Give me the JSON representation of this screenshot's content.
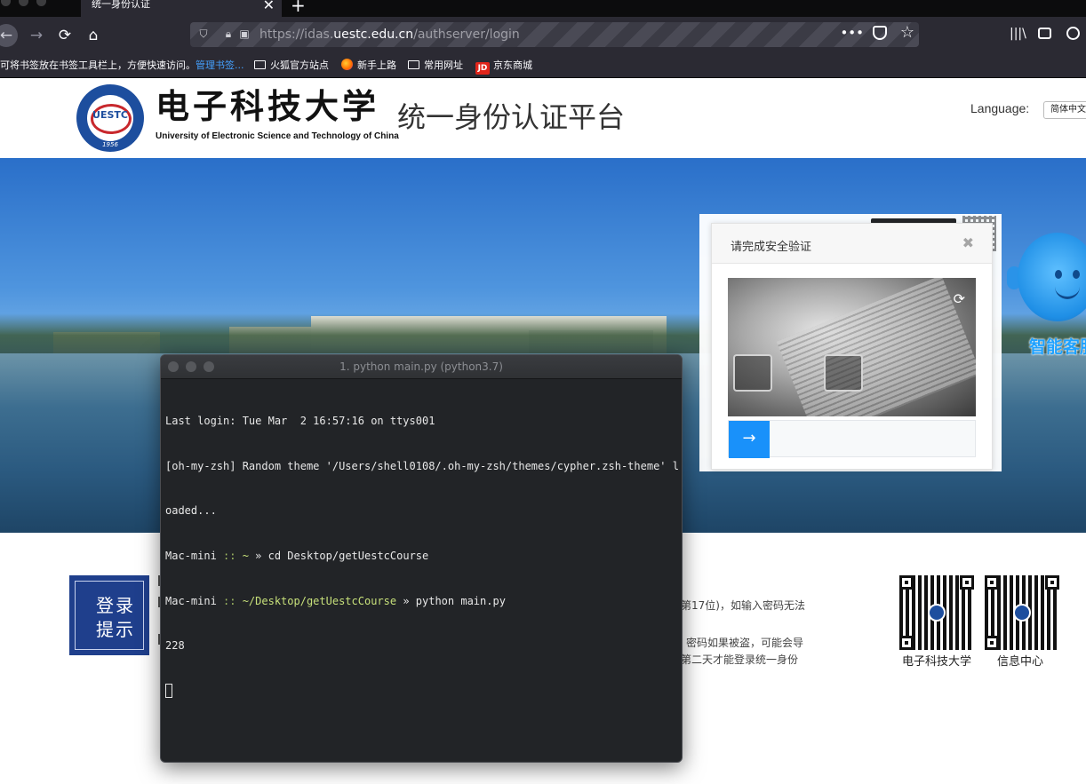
{
  "browser": {
    "tab_title": "统一身份认证",
    "tab_close": "✕",
    "new_tab": "+",
    "url_prefix": "https://idas.",
    "url_domain": "uestc.edu.cn",
    "url_path": "/authserver/login",
    "url_more": "•••",
    "nav_back": "←",
    "nav_forward": "→",
    "nav_reload": "⟳",
    "nav_home": "⌂",
    "star": "☆",
    "library": "|||\\"
  },
  "bookmarks": {
    "hint": "可将书签放在书签工具栏上，方便快速访问。",
    "manage": "管理书签...",
    "items": [
      {
        "label": "火狐官方站点",
        "icon": "folder-icon"
      },
      {
        "label": "新手上路",
        "icon": "firefox-icon"
      },
      {
        "label": "常用网址",
        "icon": "folder-icon"
      },
      {
        "label": "京东商城",
        "icon": "jd-icon",
        "icon_text": "JD"
      }
    ]
  },
  "header": {
    "logo_seal_text": "UESTC",
    "logo_year": "1956",
    "logo_cn": "电子科技大学",
    "logo_en": "University of Electronic Science and Technology of China",
    "platform_title": "统一身份认证平台",
    "language_label": "Language:",
    "language_value": "简体中文"
  },
  "captcha": {
    "title": "请完成安全验证",
    "close": "✖",
    "refresh": "⟳",
    "slider_arrow": "→"
  },
  "assistant": {
    "label": "智能客服"
  },
  "footer": {
    "tip_icon_text": "登录\n提示",
    "tip_line_1": "第17位)，如输入密码无法",
    "tip_line_2": "密码如果被盗，可能会导",
    "tip_line_3": "第二天才能登录统一身份",
    "qr_university_caption": "电子科技大学",
    "qr_infocenter_caption": "信息中心"
  },
  "terminal": {
    "title": "1. python main.py (python3.7)",
    "line1": "Last login: Tue Mar  2 16:57:16 on ttys001",
    "line2": "[oh-my-zsh] Random theme '/Users/shell0108/.oh-my-zsh/themes/cypher.zsh-theme' l",
    "line3": "oaded...",
    "prompt1_host": "Mac-mini",
    "prompt1_sep": " :: ",
    "prompt1_path": "~",
    "prompt1_arrow": " » ",
    "prompt1_cmd": "cd Desktop/getUestcCourse",
    "prompt2_host": "Mac-mini",
    "prompt2_sep": " :: ",
    "prompt2_path": "~/Desktop/getUestcCourse",
    "prompt2_arrow": " » ",
    "prompt2_cmd": "python main.py",
    "output": "228"
  }
}
